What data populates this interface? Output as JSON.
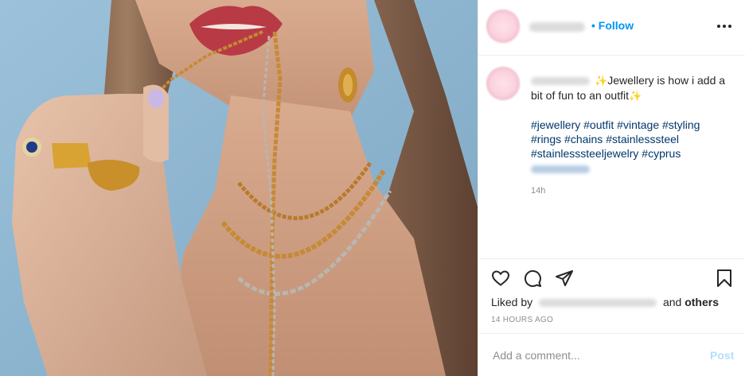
{
  "header": {
    "follow_label": "Follow",
    "more_icon": "more-horizontal-icon"
  },
  "caption": {
    "text_1": "Jewellery is how i add a bit of fun to an outfit",
    "hashtags": [
      "#jewellery",
      "#outfit",
      "#vintage",
      "#styling",
      "#rings",
      "#chains",
      "#stainlesssteel",
      "#stainlesssteeljewelry",
      "#cyprus"
    ],
    "time": "14h",
    "emoji": "sparkle-star"
  },
  "actions": {
    "like_icon": "heart-icon",
    "comment_icon": "comment-icon",
    "share_icon": "send-icon",
    "save_icon": "bookmark-icon"
  },
  "likes": {
    "prefix": "Liked by",
    "suffix": "and",
    "others": "others"
  },
  "timestamp": "14 HOURS AGO",
  "composer": {
    "placeholder": "Add a comment...",
    "post_label": "Post"
  },
  "colors": {
    "link_blue": "#0095f6",
    "hashtag": "#00376b",
    "post_disabled": "#b2dffc"
  }
}
